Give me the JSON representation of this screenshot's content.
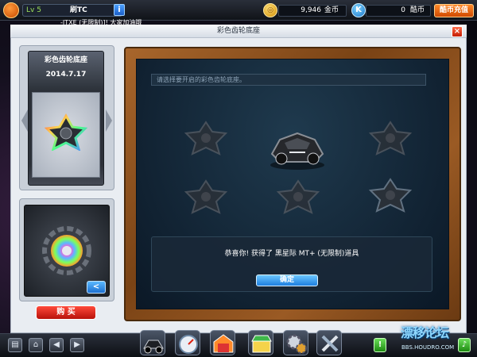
{
  "topbar": {
    "level": "Lv 5",
    "player_name": "刷TC",
    "info_label": "i",
    "coin_icon_char": "◎",
    "coins": "9,946",
    "coins_unit": "金币",
    "kcoin_icon_char": "K",
    "kcoins": "0",
    "kcoins_unit": "酷币",
    "recharge_label": "酷币充值"
  },
  "marquee": "-ITXE (无限制)]! 大家加油哦",
  "window": {
    "title": "彩色齿轮底座",
    "close_label": "×"
  },
  "item": {
    "name": "彩色齿轮底座",
    "date": "2014.7.17",
    "buy_label": "购 买",
    "preview_nav_label": "<"
  },
  "board": {
    "hint": "请选择要开启的彩色齿轮底座。",
    "result_text": "恭喜你! 获得了 黑星际 MT+ (无限制)道具",
    "confirm_label": "确定"
  },
  "bottombar": {
    "small_buttons": [
      "▤",
      "⌂",
      "◀",
      "▶"
    ],
    "green_buttons": [
      "!",
      "♪"
    ]
  },
  "watermark": {
    "forum_name": "漂移论坛",
    "url": "BBS.HOUDRO.COM"
  },
  "colors": {
    "recharge": "#e0661a",
    "buy": "#d42418",
    "confirm": "#2a8ff0",
    "frame": "#8a4f1c",
    "board": "#15293a"
  }
}
